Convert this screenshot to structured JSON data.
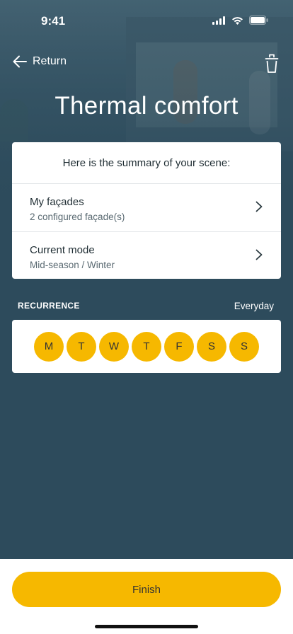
{
  "status": {
    "time": "9:41"
  },
  "nav": {
    "return_label": "Return"
  },
  "page": {
    "title": "Thermal comfort"
  },
  "summary": {
    "heading": "Here is the summary of your scene:",
    "rows": [
      {
        "title": "My façades",
        "subtitle": "2 configured façade(s)"
      },
      {
        "title": "Current mode",
        "subtitle": "Mid-season / Winter"
      }
    ]
  },
  "recurrence": {
    "label": "RECURRENCE",
    "value": "Everyday",
    "days": [
      "M",
      "T",
      "W",
      "T",
      "F",
      "S",
      "S"
    ]
  },
  "footer": {
    "finish_label": "Finish"
  },
  "colors": {
    "background": "#2d4b5c",
    "accent": "#f6b800",
    "card": "#ffffff"
  },
  "icons": {
    "back": "arrow-left-icon",
    "delete": "trash-icon",
    "row": "chevron-right-icon"
  }
}
